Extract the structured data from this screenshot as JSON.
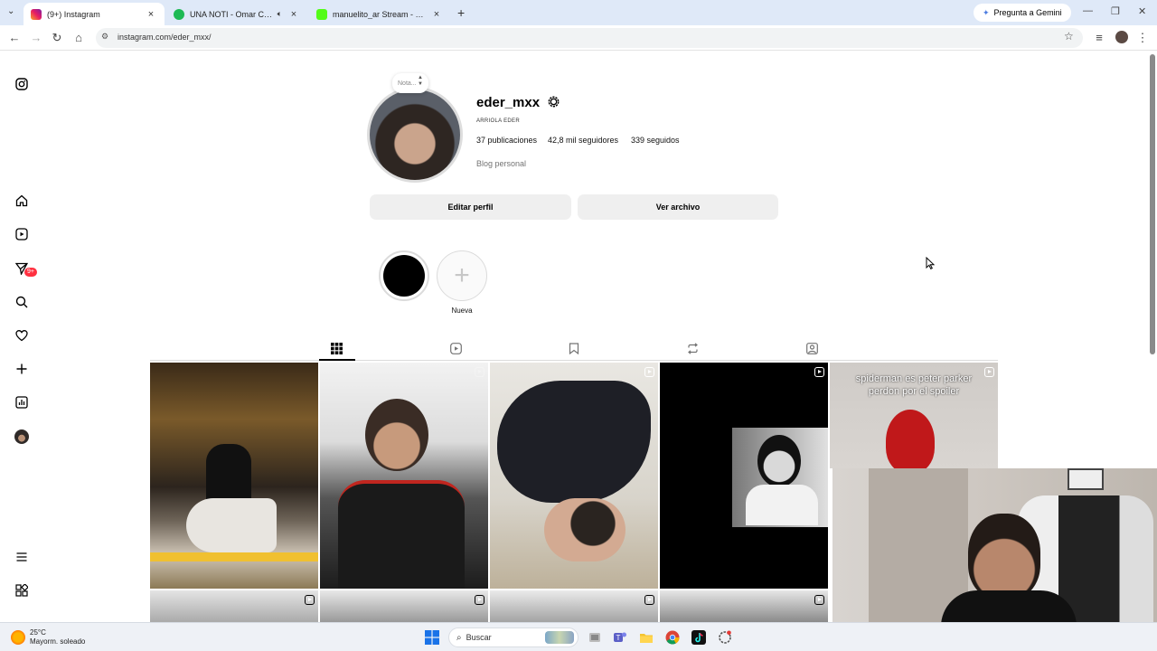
{
  "browser": {
    "tabs": [
      {
        "title": "(9+) Instagram",
        "active": true,
        "icon": "instagram-favicon"
      },
      {
        "title": "UNA NOTI - Omar Courtz",
        "active": false,
        "icon": "spotify-favicon",
        "audio": true
      },
      {
        "title": "manuelito_ar Stream - Watch Li",
        "active": false,
        "icon": "kick-favicon"
      }
    ],
    "new_tab": "+",
    "gemini_label": "Pregunta a Gemini",
    "url": "instagram.com/eder_mxx/"
  },
  "sidebar": {
    "badge": "9+",
    "items": [
      "instagram-logo",
      "home",
      "reels",
      "messages",
      "search",
      "notifications",
      "create",
      "dashboard",
      "profile",
      "more",
      "threads"
    ]
  },
  "profile": {
    "note": "Nota...",
    "username": "eder_mxx",
    "full_name": "ARRIOLA EDER",
    "stats": {
      "posts": "37 publicaciones",
      "followers": "42,8 mil seguidores",
      "following": "339 seguidos"
    },
    "category": "Blog personal",
    "edit_button": "Editar perfil",
    "archive_button": "Ver archivo"
  },
  "highlights": {
    "new_label": "Nueva"
  },
  "posts": {
    "spiderman_caption_line1": "spiderman es peter parker",
    "spiderman_caption_line2": "perdon por el spoiler"
  },
  "taskbar": {
    "temperature": "25°C",
    "weather": "Mayorm. soleado",
    "search_label": "Buscar"
  },
  "colors": {
    "tabstrip": "#dfe9f8",
    "badge": "#ff3040",
    "pill_button": "#efefef"
  }
}
